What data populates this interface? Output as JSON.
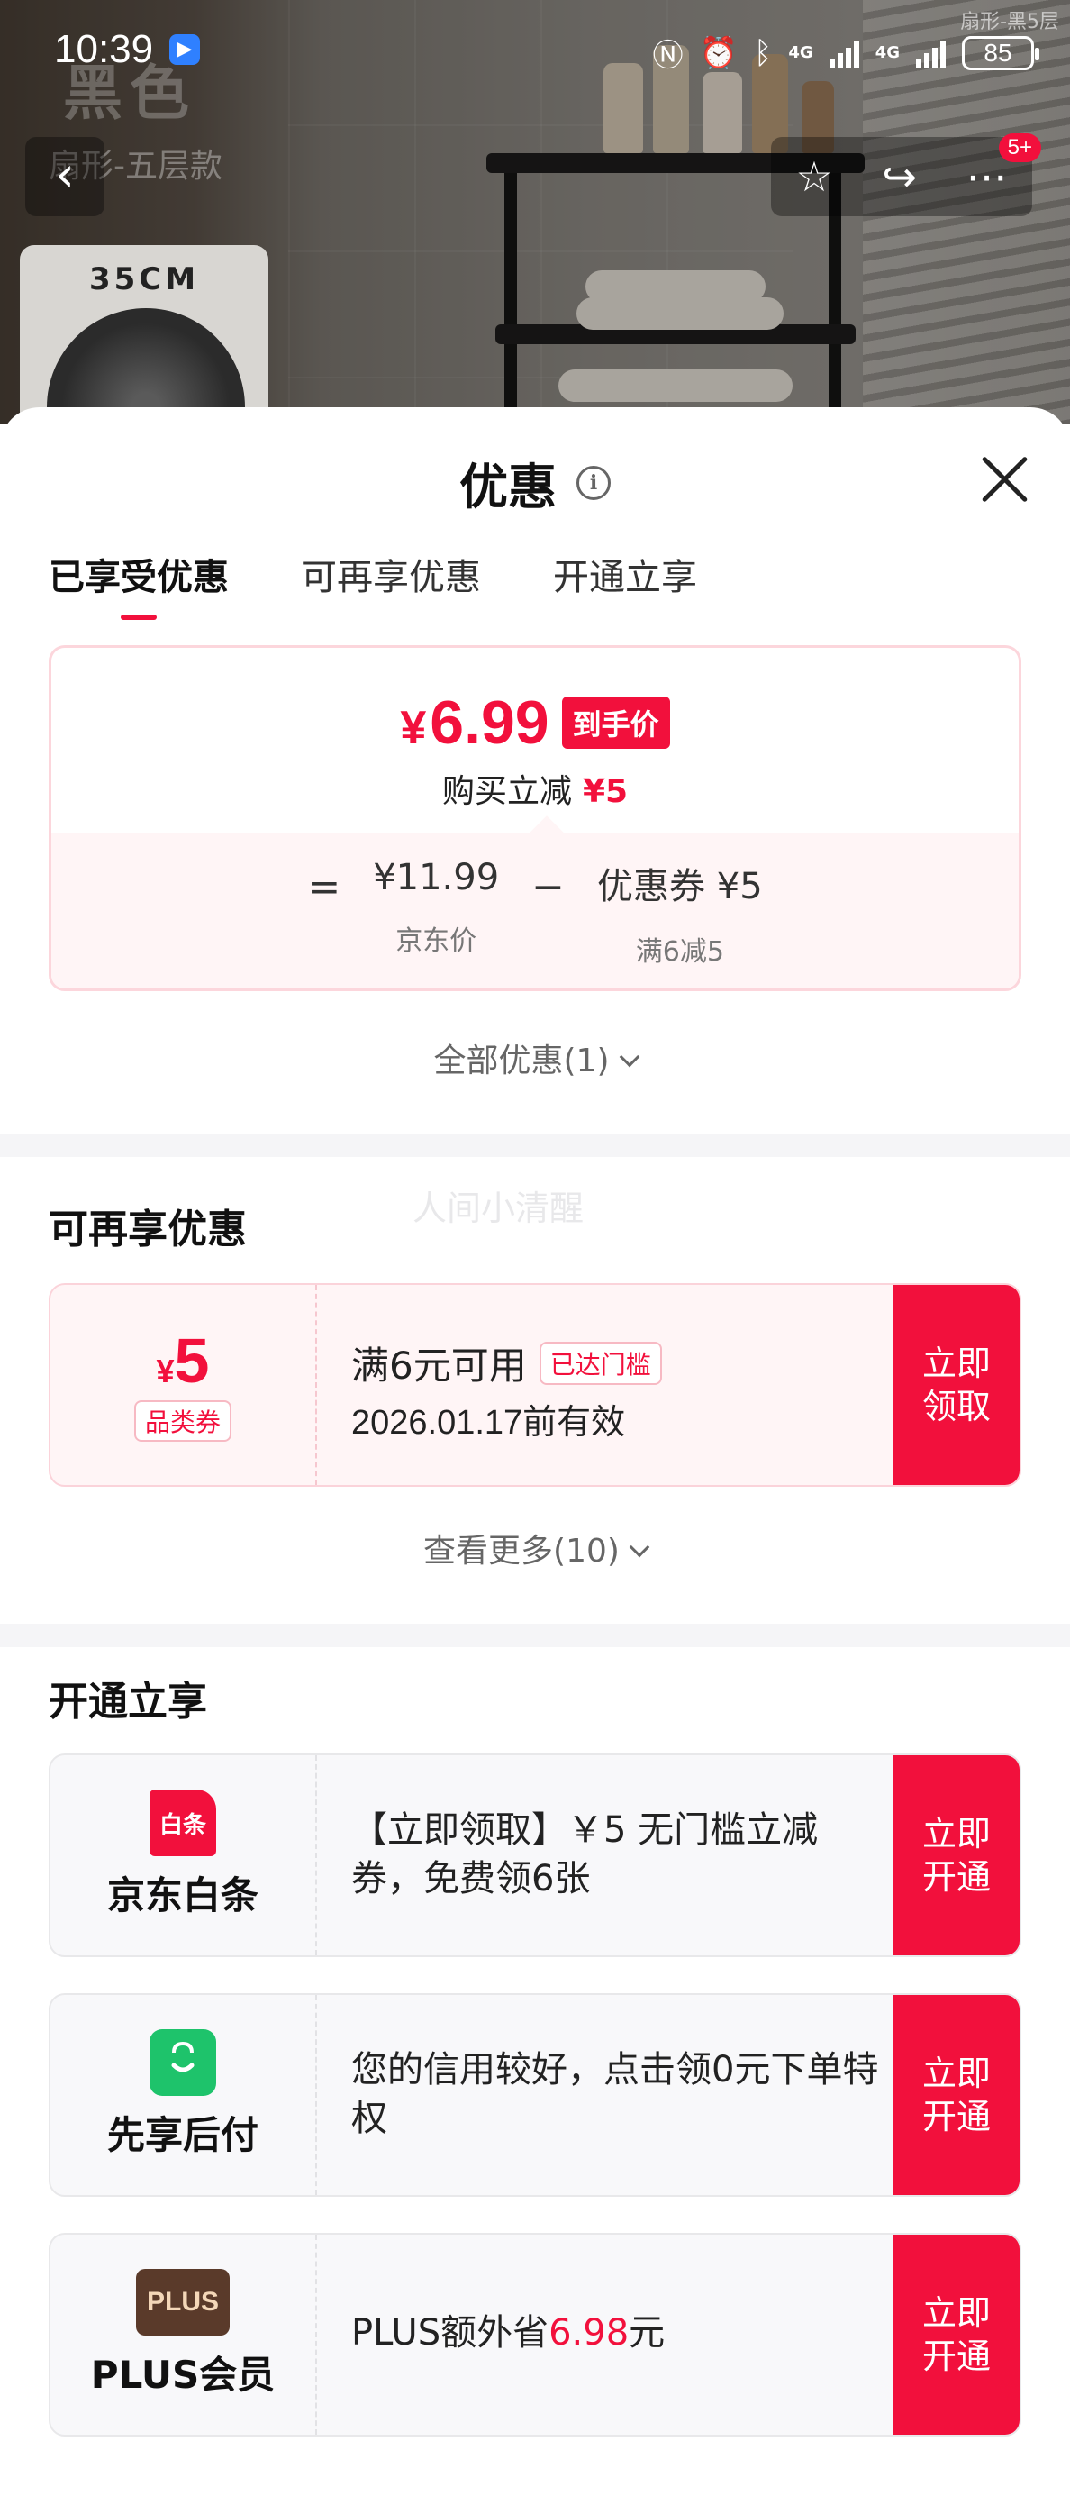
{
  "status_bar": {
    "time": "10:39",
    "network_1": "4G",
    "network_2": "4G",
    "battery": "85"
  },
  "background": {
    "product_title": "黑色",
    "product_subtitle": "扇形-五层款",
    "size_label": "35CM",
    "corner_label": "扇形-黑5层",
    "more_badge": "5+"
  },
  "sheet": {
    "title": "优惠",
    "tabs": [
      {
        "label": "已享受优惠",
        "active": true
      },
      {
        "label": "可再享优惠",
        "active": false
      },
      {
        "label": "开通立享",
        "active": false
      }
    ]
  },
  "price_card": {
    "currency": "¥",
    "final_price": "6.99",
    "final_tag": "到手价",
    "desc_text": "购买立减",
    "desc_amount": "¥5",
    "equals": "=",
    "jd_price": "¥11.99",
    "jd_price_label": "京东价",
    "minus": "−",
    "coupon_text": "优惠券 ¥5",
    "coupon_label": "满6减5"
  },
  "all_deals": "全部优惠(1)",
  "more_deals": {
    "section_title": "可再享优惠",
    "watermark": "人间小清醒",
    "coupon": {
      "currency": "¥",
      "amount": "5",
      "type": "品类券",
      "condition": "满6元可用",
      "threshold_pill": "已达门槛",
      "expiry": "2026.01.17前有效",
      "action": "立即领取"
    },
    "see_more": "查看更多(10)"
  },
  "open_now": {
    "section_title": "开通立享",
    "cards": [
      {
        "name": "京东白条",
        "logo_text": "白条",
        "desc": "【立即领取】￥5 无门槛立减券，免费领6张",
        "action": "立即开通"
      },
      {
        "name": "先享后付",
        "logo_text": "",
        "desc": "您的信用较好，点击领0元下单特权",
        "action": "立即开通"
      },
      {
        "name": "PLUS会员",
        "logo_text": "PLUS",
        "desc_prefix": "PLUS额外省",
        "desc_amount": "6.98",
        "desc_suffix": "元",
        "action": "立即开通"
      }
    ]
  },
  "colors": {
    "accent_red": "#f2103c",
    "pink_border": "#fcd6dc",
    "pink_bg": "#fff5f6",
    "green": "#1ec36b"
  }
}
